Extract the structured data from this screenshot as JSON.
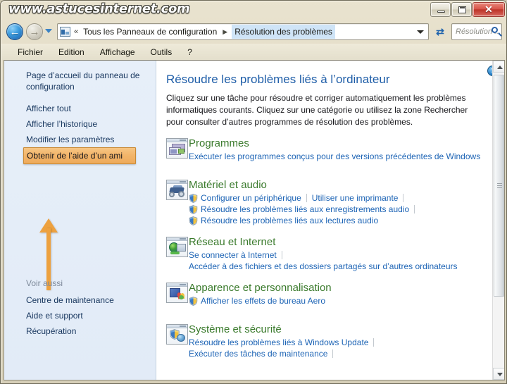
{
  "watermark": "www.astucesinternet.com",
  "titlebar": {
    "minimize_label": "Réduire",
    "maximize_label": "Agrandir",
    "close_label": "✕"
  },
  "address_bar": {
    "back_glyph": "←",
    "forward_glyph": "→",
    "chevrons": "«",
    "crumbs": [
      {
        "label": "Tous les Panneaux de configuration",
        "current": false
      },
      {
        "label": "Résolution des problèmes",
        "current": true
      }
    ],
    "separator": "▶",
    "refresh_glyph": "⇄"
  },
  "search": {
    "placeholder": "Résolution ..."
  },
  "menu": {
    "items": [
      "Fichier",
      "Edition",
      "Affichage",
      "Outils",
      "?"
    ]
  },
  "sidebar": {
    "items": [
      {
        "label": "Page d’accueil du panneau de configuration",
        "active": false
      },
      {
        "label": "Afficher tout",
        "active": false
      },
      {
        "label": "Afficher l’historique",
        "active": false
      },
      {
        "label": "Modifier les paramètres",
        "active": false
      },
      {
        "label": "Obtenir de l’aide d’un ami",
        "active": true
      }
    ],
    "see_also_title": "Voir aussi",
    "see_also_items": [
      "Centre de maintenance",
      "Aide et support",
      "Récupération"
    ]
  },
  "main": {
    "help_glyph": "?",
    "title": "Résoudre les problèmes liés à l’ordinateur",
    "intro": "Cliquez sur une tâche pour résoudre et corriger automatiquement les problèmes informatiques courants. Cliquez sur une catégorie ou utilisez la zone Rechercher pour consulter d’autres programmes de résolution des problèmes.",
    "categories": [
      {
        "title": "Programmes",
        "icon": "programs-icon",
        "rows": [
          [
            {
              "label": "Exécuter les programmes conçus pour des versions précédentes de Windows",
              "shield": false,
              "sep_after": false
            }
          ]
        ]
      },
      {
        "title": "Matériel et audio",
        "icon": "hardware-audio-icon",
        "rows": [
          [
            {
              "label": "Configurer un périphérique",
              "shield": true,
              "sep_after": true
            },
            {
              "label": "Utiliser une imprimante",
              "shield": false,
              "sep_after": true
            }
          ],
          [
            {
              "label": "Résoudre les problèmes liés aux enregistrements audio",
              "shield": true,
              "sep_after": true
            }
          ],
          [
            {
              "label": "Résoudre les problèmes liés aux lectures audio",
              "shield": true,
              "sep_after": false
            }
          ]
        ]
      },
      {
        "title": "Réseau et Internet",
        "icon": "network-internet-icon",
        "rows": [
          [
            {
              "label": "Se connecter à Internet",
              "shield": false,
              "sep_after": true
            }
          ],
          [
            {
              "label": "Accéder à des fichiers et des dossiers partagés sur d’autres ordinateurs",
              "shield": false,
              "sep_after": false
            }
          ]
        ]
      },
      {
        "title": "Apparence et personnalisation",
        "icon": "appearance-icon",
        "rows": [
          [
            {
              "label": "Afficher les effets de bureau Aero",
              "shield": true,
              "sep_after": false
            }
          ]
        ]
      },
      {
        "title": "Système et sécurité",
        "icon": "system-security-icon",
        "rows": [
          [
            {
              "label": "Résoudre les problèmes liés à Windows Update",
              "shield": false,
              "sep_after": true
            }
          ],
          [
            {
              "label": "Exécuter des tâches de maintenance",
              "shield": false,
              "sep_after": true
            }
          ]
        ]
      }
    ]
  },
  "colors": {
    "link": "#1d64b5",
    "category_title": "#3a7a2c",
    "page_title": "#1f5ea8",
    "highlight": "#f2b469",
    "arrow": "#eda13f",
    "sidebar_bg": "#e4edf8"
  }
}
